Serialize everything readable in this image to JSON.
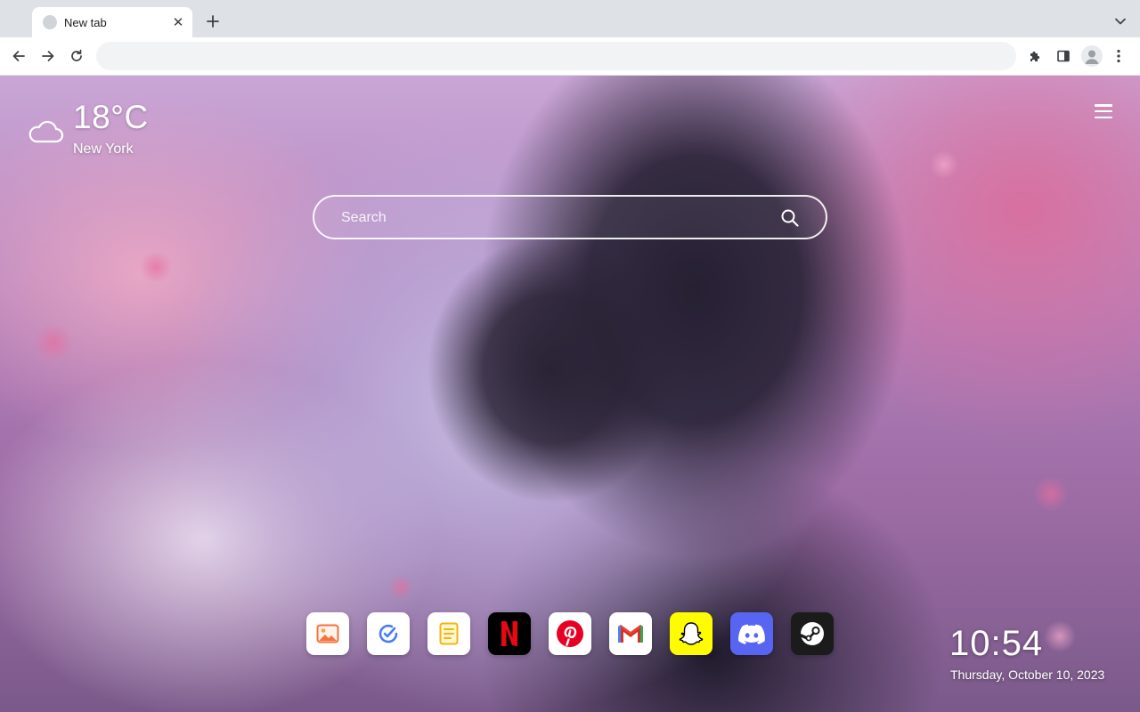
{
  "browser": {
    "tab": {
      "title": "New tab",
      "close_glyph": "✕"
    },
    "new_tab_glyph": "+",
    "tab_search_glyph": "⌄",
    "omnibox": {
      "value": "",
      "placeholder": ""
    }
  },
  "weather": {
    "temperature": "18°C",
    "city": "New York",
    "icon": "cloud-icon"
  },
  "search": {
    "placeholder": "Search"
  },
  "apps": [
    {
      "name": "Photos",
      "icon": "image-icon",
      "color": "#ffffff"
    },
    {
      "name": "Tasks",
      "icon": "check-circle-icon",
      "color": "#ffffff"
    },
    {
      "name": "Notes",
      "icon": "notepad-icon",
      "color": "#ffffff"
    },
    {
      "name": "Netflix",
      "icon": "netflix-icon",
      "color": "#000000"
    },
    {
      "name": "Pinterest",
      "icon": "pinterest-icon",
      "color": "#ffffff"
    },
    {
      "name": "Gmail",
      "icon": "gmail-icon",
      "color": "#ffffff"
    },
    {
      "name": "Snapchat",
      "icon": "snapchat-icon",
      "color": "#fffc00"
    },
    {
      "name": "Discord",
      "icon": "discord-icon",
      "color": "#5865f2"
    },
    {
      "name": "Steam",
      "icon": "steam-icon",
      "color": "#1b1b1b"
    }
  ],
  "clock": {
    "time": "10:54",
    "date": "Thursday, October 10, 2023"
  },
  "colors": {
    "tabstrip": "#dee1e6",
    "toolbar": "#ffffff",
    "omnibox": "#f1f3f4",
    "netflix_red": "#e50914",
    "pinterest_red": "#e60023",
    "discord_blue": "#5865f2",
    "snapchat_yellow": "#fffc00"
  }
}
